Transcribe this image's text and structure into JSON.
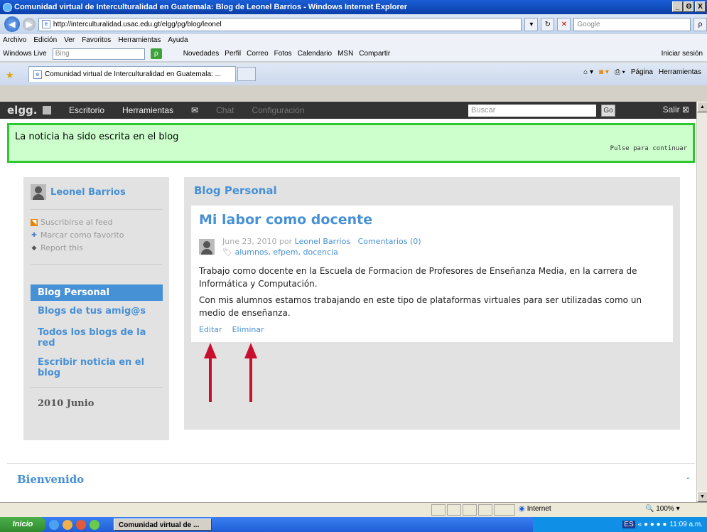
{
  "window": {
    "title": "Comunidad virtual de Interculturalidad en Guatemala: Blog de Leonel Barrios - Windows Internet Explorer",
    "buttons": [
      "_",
      "Θ",
      "X"
    ]
  },
  "address": {
    "back_glyph": "◀",
    "forward_glyph": "▶",
    "url": "http://interculturalidad.usac.edu.gt/elgg/pg/blog/leonel",
    "search_placeholder": "Google",
    "search_btn": "ρ"
  },
  "menu": [
    "Archivo",
    "Edición",
    "Ver",
    "Favoritos",
    "Herramientas",
    "Ayuda"
  ],
  "live_toolbar": {
    "brand": "Windows Live",
    "search_placeholder": "Bing",
    "links": [
      "Novedades",
      "Perfil",
      "Correo",
      "Fotos",
      "Calendario",
      "MSN",
      "Compartir"
    ],
    "signin": "Iniciar sesión"
  },
  "tab": {
    "label": "Comunidad virtual de Interculturalidad en Guatemala: ...",
    "page": "Página",
    "tools": "Herramientas"
  },
  "elgg": {
    "logo": "elgg.",
    "nav": [
      "Escritorio",
      "Herramientas",
      "Chat",
      "Configuración"
    ],
    "search_placeholder": "Buscar",
    "go": "Go",
    "logout": "Salir"
  },
  "notice": {
    "message": "La noticia ha sido escrita en el blog",
    "dismiss": "Pulse para continuar"
  },
  "sidebar": {
    "owner": "Leonel Barrios",
    "links": [
      "Suscribirse al feed",
      "Marcar como favorito",
      "Report this"
    ],
    "nav_active": "Blog Personal",
    "nav": [
      "Blogs de tus amig@s",
      "Todos los blogs de la red",
      "Escribir noticia en el blog"
    ],
    "archive": "2010 Junio"
  },
  "main": {
    "title": "Blog Personal",
    "post": {
      "title": "Mi labor como docente",
      "date": "June 23, 2010 por",
      "author": "Leonel Barrios",
      "comments": "Comentarios (0)",
      "tags": "alumnos, efpem, docencia",
      "para1": "Trabajo como docente en la Escuela de Formacion de Profesores de Enseñanza Media, en la carrera de Informática y Computación.",
      "para2": "Con mis alumnos estamos trabajando en este tipo de plataformas virtuales para ser utilizadas como un medio de enseñanza.",
      "edit": "Editar",
      "delete": "Eliminar"
    }
  },
  "welcome": {
    "title": "Bienvenido",
    "toggle": "-"
  },
  "status": {
    "zone": "Internet",
    "zoom": "100%"
  },
  "taskbar": {
    "start": "Inicio",
    "task": "Comunidad virtual de ...",
    "clock": "11:09 a.m."
  },
  "colors": {
    "elgg_blue": "#4690d6",
    "notice_green": "#2fc72f",
    "annotation_red": "#c8102e"
  }
}
